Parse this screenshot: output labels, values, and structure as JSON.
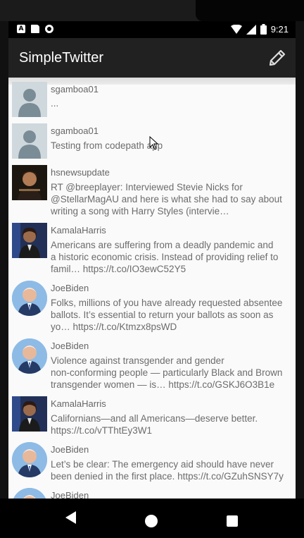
{
  "status_bar": {
    "time": "9:21",
    "a_icon_label": "A"
  },
  "app_bar": {
    "title": "SimpleTwitter"
  },
  "tweets": [
    {
      "user": "sgamboa01",
      "body": "...",
      "avatar": "default"
    },
    {
      "user": "sgamboa01",
      "body": "Testing from codepath app",
      "avatar": "default"
    },
    {
      "user": "hsnewsupdate",
      "body": "RT @breeplayer: Interviewed Stevie Nicks for\n@StellarMagAU and here is what she had to say about\nwriting a song with Harry Styles (intervie…",
      "avatar": "photo-dark"
    },
    {
      "user": "KamalaHarris",
      "body": "Americans are suffering from a deadly pandemic and\na historic economic crisis. Instead of providing relief to\nfamil… https://t.co/IO3ewC52Y5",
      "avatar": "photo-kamala"
    },
    {
      "user": "JoeBiden",
      "body": "Folks, millions of you have already requested absentee\nballots. It’s essential to return your ballots as soon as\nyo… https://t.co/Ktmzx8psWD",
      "avatar": "photo-joe"
    },
    {
      "user": "JoeBiden",
      "body": "Violence against transgender and gender\nnon-conforming people — particularly Black and Brown\ntransgender women — is… https://t.co/GSKJ6O3B1e",
      "avatar": "photo-joe"
    },
    {
      "user": "KamalaHarris",
      "body": "Californians—and all Americans—deserve better.\nhttps://t.co/vTThtEy3W1",
      "avatar": "photo-kamala"
    },
    {
      "user": "JoeBiden",
      "body": "Let’s be clear: The emergency aid should have never\nbeen denied in the first place. https://t.co/GZuhSNSY7y",
      "avatar": "photo-joe"
    },
    {
      "user": "JoeBiden",
      "body": "",
      "avatar": "photo-joe"
    }
  ],
  "colors": {
    "app_bar": "#212121",
    "content_bg": "#fafafa",
    "username": "#666666",
    "body": "#6c6c6c"
  }
}
